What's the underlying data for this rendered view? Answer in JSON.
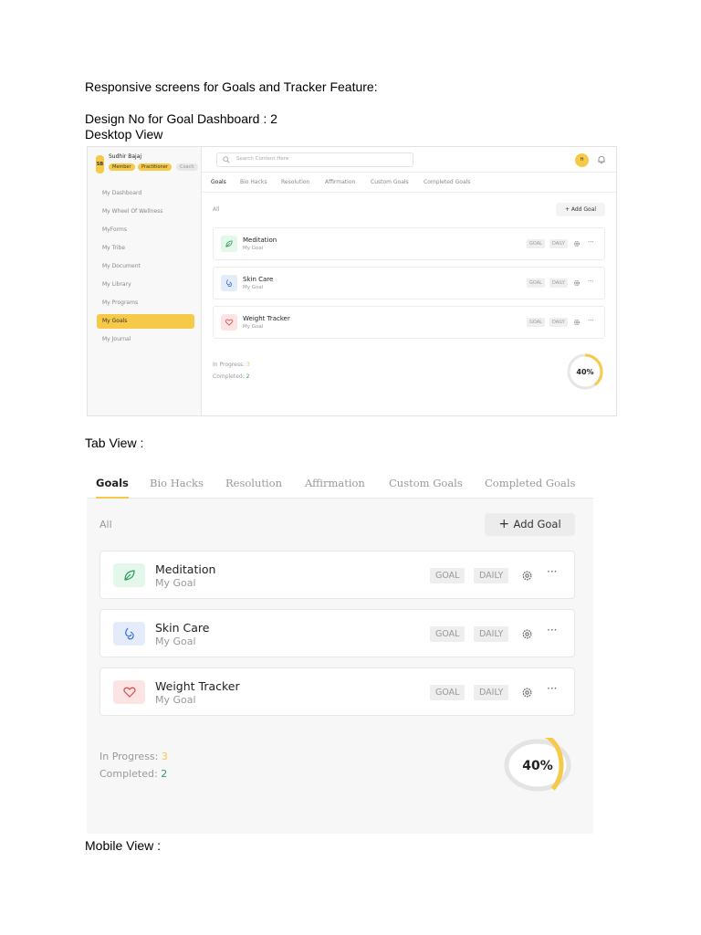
{
  "doc": {
    "heading": "Responsive screens for Goals and Tracker Feature:",
    "design_no": "Design No for Goal Dashboard  : 2",
    "desktop_label": "Desktop View",
    "tab_label": "Tab View :",
    "mobile_label": "Mobile View :"
  },
  "colors": {
    "accent": "#f7c948",
    "completed": "#2e9d5b",
    "meditation_bg": "#e3f7ea",
    "skincare_bg": "#e4ebfb",
    "weight_bg": "#fde4e4"
  },
  "desktop": {
    "profile": {
      "initials": "SB",
      "name": "Sudhir Bajaj",
      "roles": [
        "Member",
        "Practitioner",
        "Coach"
      ]
    },
    "nav": [
      "My Dashboard",
      "My Wheel Of Wellness",
      "MyForms",
      "My Tribe",
      "My Document",
      "My Library",
      "My Programs",
      "My Goals",
      "My Journal"
    ],
    "active_nav": "My Goals",
    "search_placeholder": "Search Content Here",
    "user_initial": "H",
    "tabs": [
      "Goals",
      "Bio Hacks",
      "Resolution",
      "Affirmation",
      "Custom Goals",
      "Completed Goals"
    ],
    "filter": "All",
    "add_goal": "Add Goal",
    "goals": [
      {
        "title": "Meditation",
        "subtitle": "My Goal",
        "icon": "leaf-icon",
        "tags": [
          "GOAL",
          "DAILY"
        ]
      },
      {
        "title": "Skin Care",
        "subtitle": "My Goal",
        "icon": "drop-icon",
        "tags": [
          "GOAL",
          "DAILY"
        ]
      },
      {
        "title": "Weight Tracker",
        "subtitle": "My Goal",
        "icon": "heart-icon",
        "tags": [
          "GOAL",
          "DAILY"
        ]
      }
    ],
    "in_progress_label": "In Progress:",
    "in_progress_value": "3",
    "completed_label": "Completed:",
    "completed_value": "2",
    "progress_text": "40%",
    "progress_fraction": 0.4
  },
  "tab": {
    "tabs": [
      "Goals",
      "Bio Hacks",
      "Resolution",
      "Affirmation",
      "Custom Goals",
      "Completed Goals"
    ],
    "filter": "All",
    "add_goal": "Add Goal",
    "goals": [
      {
        "title": "Meditation",
        "subtitle": "My Goal",
        "icon": "leaf-icon",
        "tags": [
          "GOAL",
          "DAILY"
        ]
      },
      {
        "title": "Skin Care",
        "subtitle": "My Goal",
        "icon": "drop-icon",
        "tags": [
          "GOAL",
          "DAILY"
        ]
      },
      {
        "title": "Weight Tracker",
        "subtitle": "My Goal",
        "icon": "heart-icon",
        "tags": [
          "GOAL",
          "DAILY"
        ]
      }
    ],
    "in_progress_label": "In Progress:",
    "in_progress_value": "3",
    "completed_label": "Completed:",
    "completed_value": "2",
    "progress_text": "40%",
    "progress_fraction": 0.4
  }
}
